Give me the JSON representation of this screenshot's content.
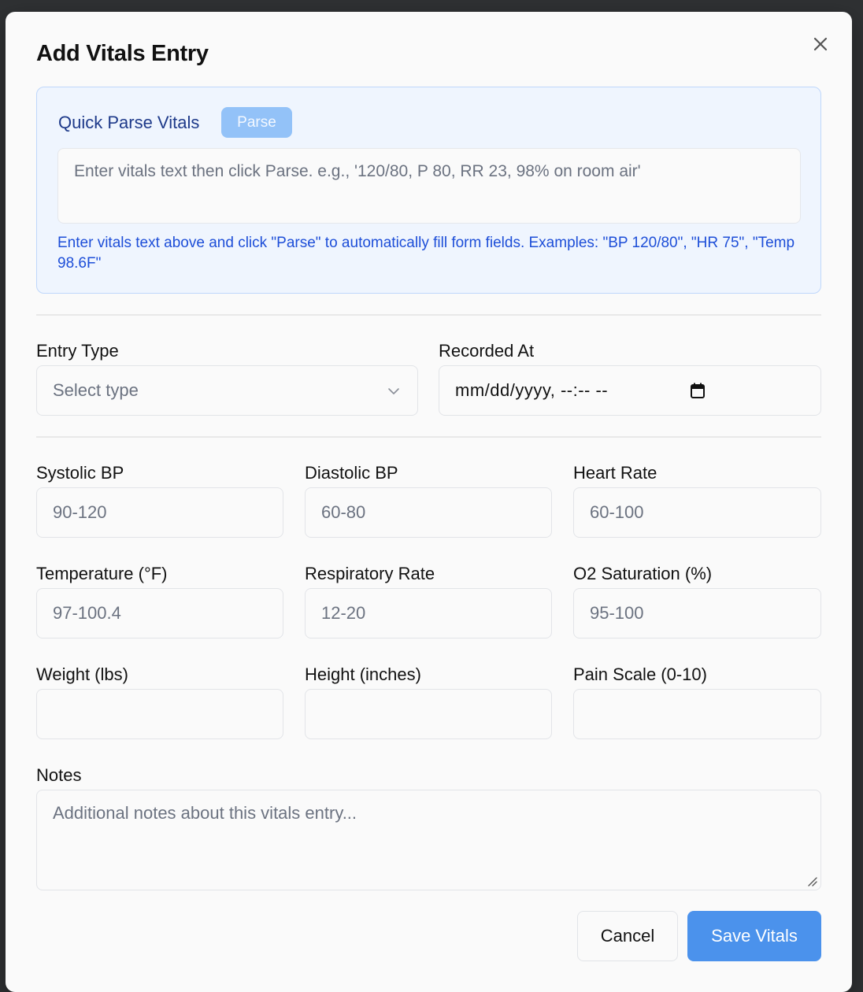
{
  "modal": {
    "title": "Add Vitals Entry",
    "close_icon": "close-icon"
  },
  "quick_parse": {
    "title": "Quick Parse Vitals",
    "button_label": "Parse",
    "placeholder": "Enter vitals text then click Parse. e.g., '120/80, P 80, RR 23, 98% on room air'",
    "help_text": "Enter vitals text above and click \"Parse\" to automatically fill form fields. Examples: \"BP 120/80\", \"HR 75\", \"Temp 98.6F\""
  },
  "entry_type": {
    "label": "Entry Type",
    "placeholder": "Select type",
    "icon": "chevron-down-icon"
  },
  "recorded_at": {
    "label": "Recorded At",
    "value": "mm/dd/yyyy, --:-- --",
    "icon": "calendar-icon"
  },
  "vitals": {
    "systolic": {
      "label": "Systolic BP",
      "placeholder": "90-120"
    },
    "diastolic": {
      "label": "Diastolic BP",
      "placeholder": "60-80"
    },
    "heart_rate": {
      "label": "Heart Rate",
      "placeholder": "60-100"
    },
    "temperature": {
      "label": "Temperature (°F)",
      "placeholder": "97-100.4"
    },
    "respiratory_rate": {
      "label": "Respiratory Rate",
      "placeholder": "12-20"
    },
    "o2_saturation": {
      "label": "O2 Saturation (%)",
      "placeholder": "95-100"
    },
    "weight": {
      "label": "Weight (lbs)",
      "placeholder": ""
    },
    "height": {
      "label": "Height (inches)",
      "placeholder": ""
    },
    "pain_scale": {
      "label": "Pain Scale (0-10)",
      "placeholder": ""
    }
  },
  "notes": {
    "label": "Notes",
    "placeholder": "Additional notes about this vitals entry..."
  },
  "actions": {
    "cancel_label": "Cancel",
    "save_label": "Save Vitals"
  },
  "colors": {
    "primary": "#4b92ec",
    "parse_button": "#93c2f8",
    "parse_box_bg": "#eff5fe",
    "parse_title": "#1e3a8a",
    "help_text": "#1d4ed8"
  }
}
